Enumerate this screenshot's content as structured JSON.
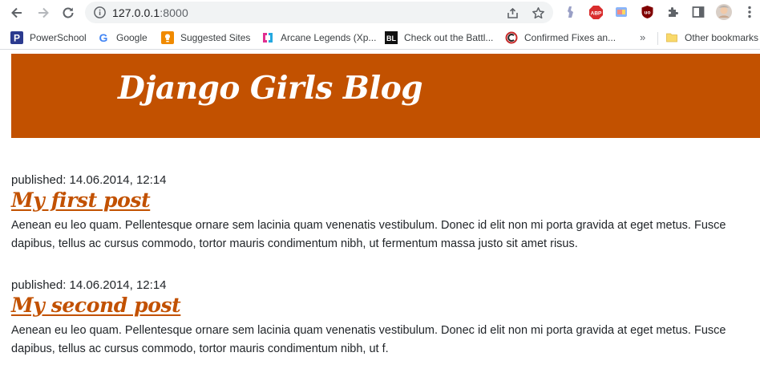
{
  "browser": {
    "url_host": "127.0.0.1",
    "url_port": ":8000",
    "bookmarks": [
      {
        "label": "PowerSchool",
        "icon": "powerschool-icon"
      },
      {
        "label": "Google",
        "icon": "google-icon"
      },
      {
        "label": "Suggested Sites",
        "icon": "suggested-sites-icon"
      },
      {
        "label": "Arcane Legends (Xp...",
        "icon": "arcane-legends-icon"
      },
      {
        "label": "Check out the Battl...",
        "icon": "bl-icon"
      },
      {
        "label": "Confirmed Fixes an...",
        "icon": "confirmed-fixes-icon"
      }
    ],
    "more_label": "»",
    "other_bookmarks": "Other bookmarks",
    "colors": {
      "accent": "#C25100",
      "chrome_bg": "#f1f3f4"
    }
  },
  "site": {
    "title": "Django Girls Blog"
  },
  "posts": [
    {
      "published": "published: 14.06.2014, 12:14",
      "title": "My first post",
      "body": "Aenean eu leo quam. Pellentesque ornare sem lacinia quam venenatis vestibulum. Donec id elit non mi porta gravida at eget metus. Fusce dapibus, tellus ac cursus commodo, tortor mauris condimentum nibh, ut fermentum massa justo sit amet risus."
    },
    {
      "published": "published: 14.06.2014, 12:14",
      "title": "My second post",
      "body": "Aenean eu leo quam. Pellentesque ornare sem lacinia quam venenatis vestibulum. Donec id elit non mi porta gravida at eget metus. Fusce dapibus, tellus ac cursus commodo, tortor mauris condimentum nibh, ut f."
    }
  ]
}
